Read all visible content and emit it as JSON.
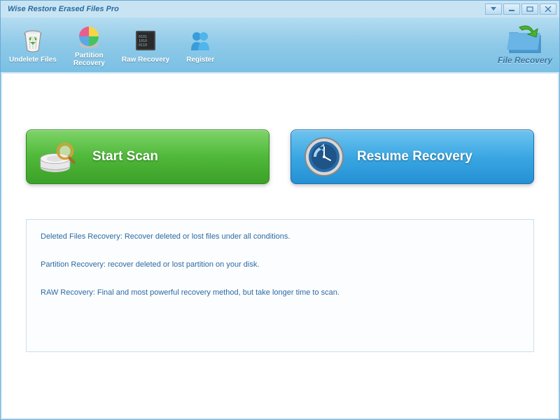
{
  "window": {
    "title": "Wise Restore Erased Files Pro"
  },
  "toolbar": {
    "items": [
      {
        "label": "Undelete Files",
        "icon": "recycle-bin"
      },
      {
        "label": "Partition\nRecovery",
        "icon": "pie-chart"
      },
      {
        "label": "Raw Recovery",
        "icon": "binary-disk"
      },
      {
        "label": "Register",
        "icon": "people"
      }
    ],
    "right_label": "File Recovery"
  },
  "actions": {
    "scan_label": "Start  Scan",
    "resume_label": "Resume Recovery"
  },
  "info": {
    "line1": "Deleted Files Recovery: Recover deleted or lost files  under all conditions.",
    "line2": "Partition Recovery: recover deleted or lost partition on your disk.",
    "line3": "RAW Recovery: Final and most powerful recovery method, but take longer time to scan."
  }
}
